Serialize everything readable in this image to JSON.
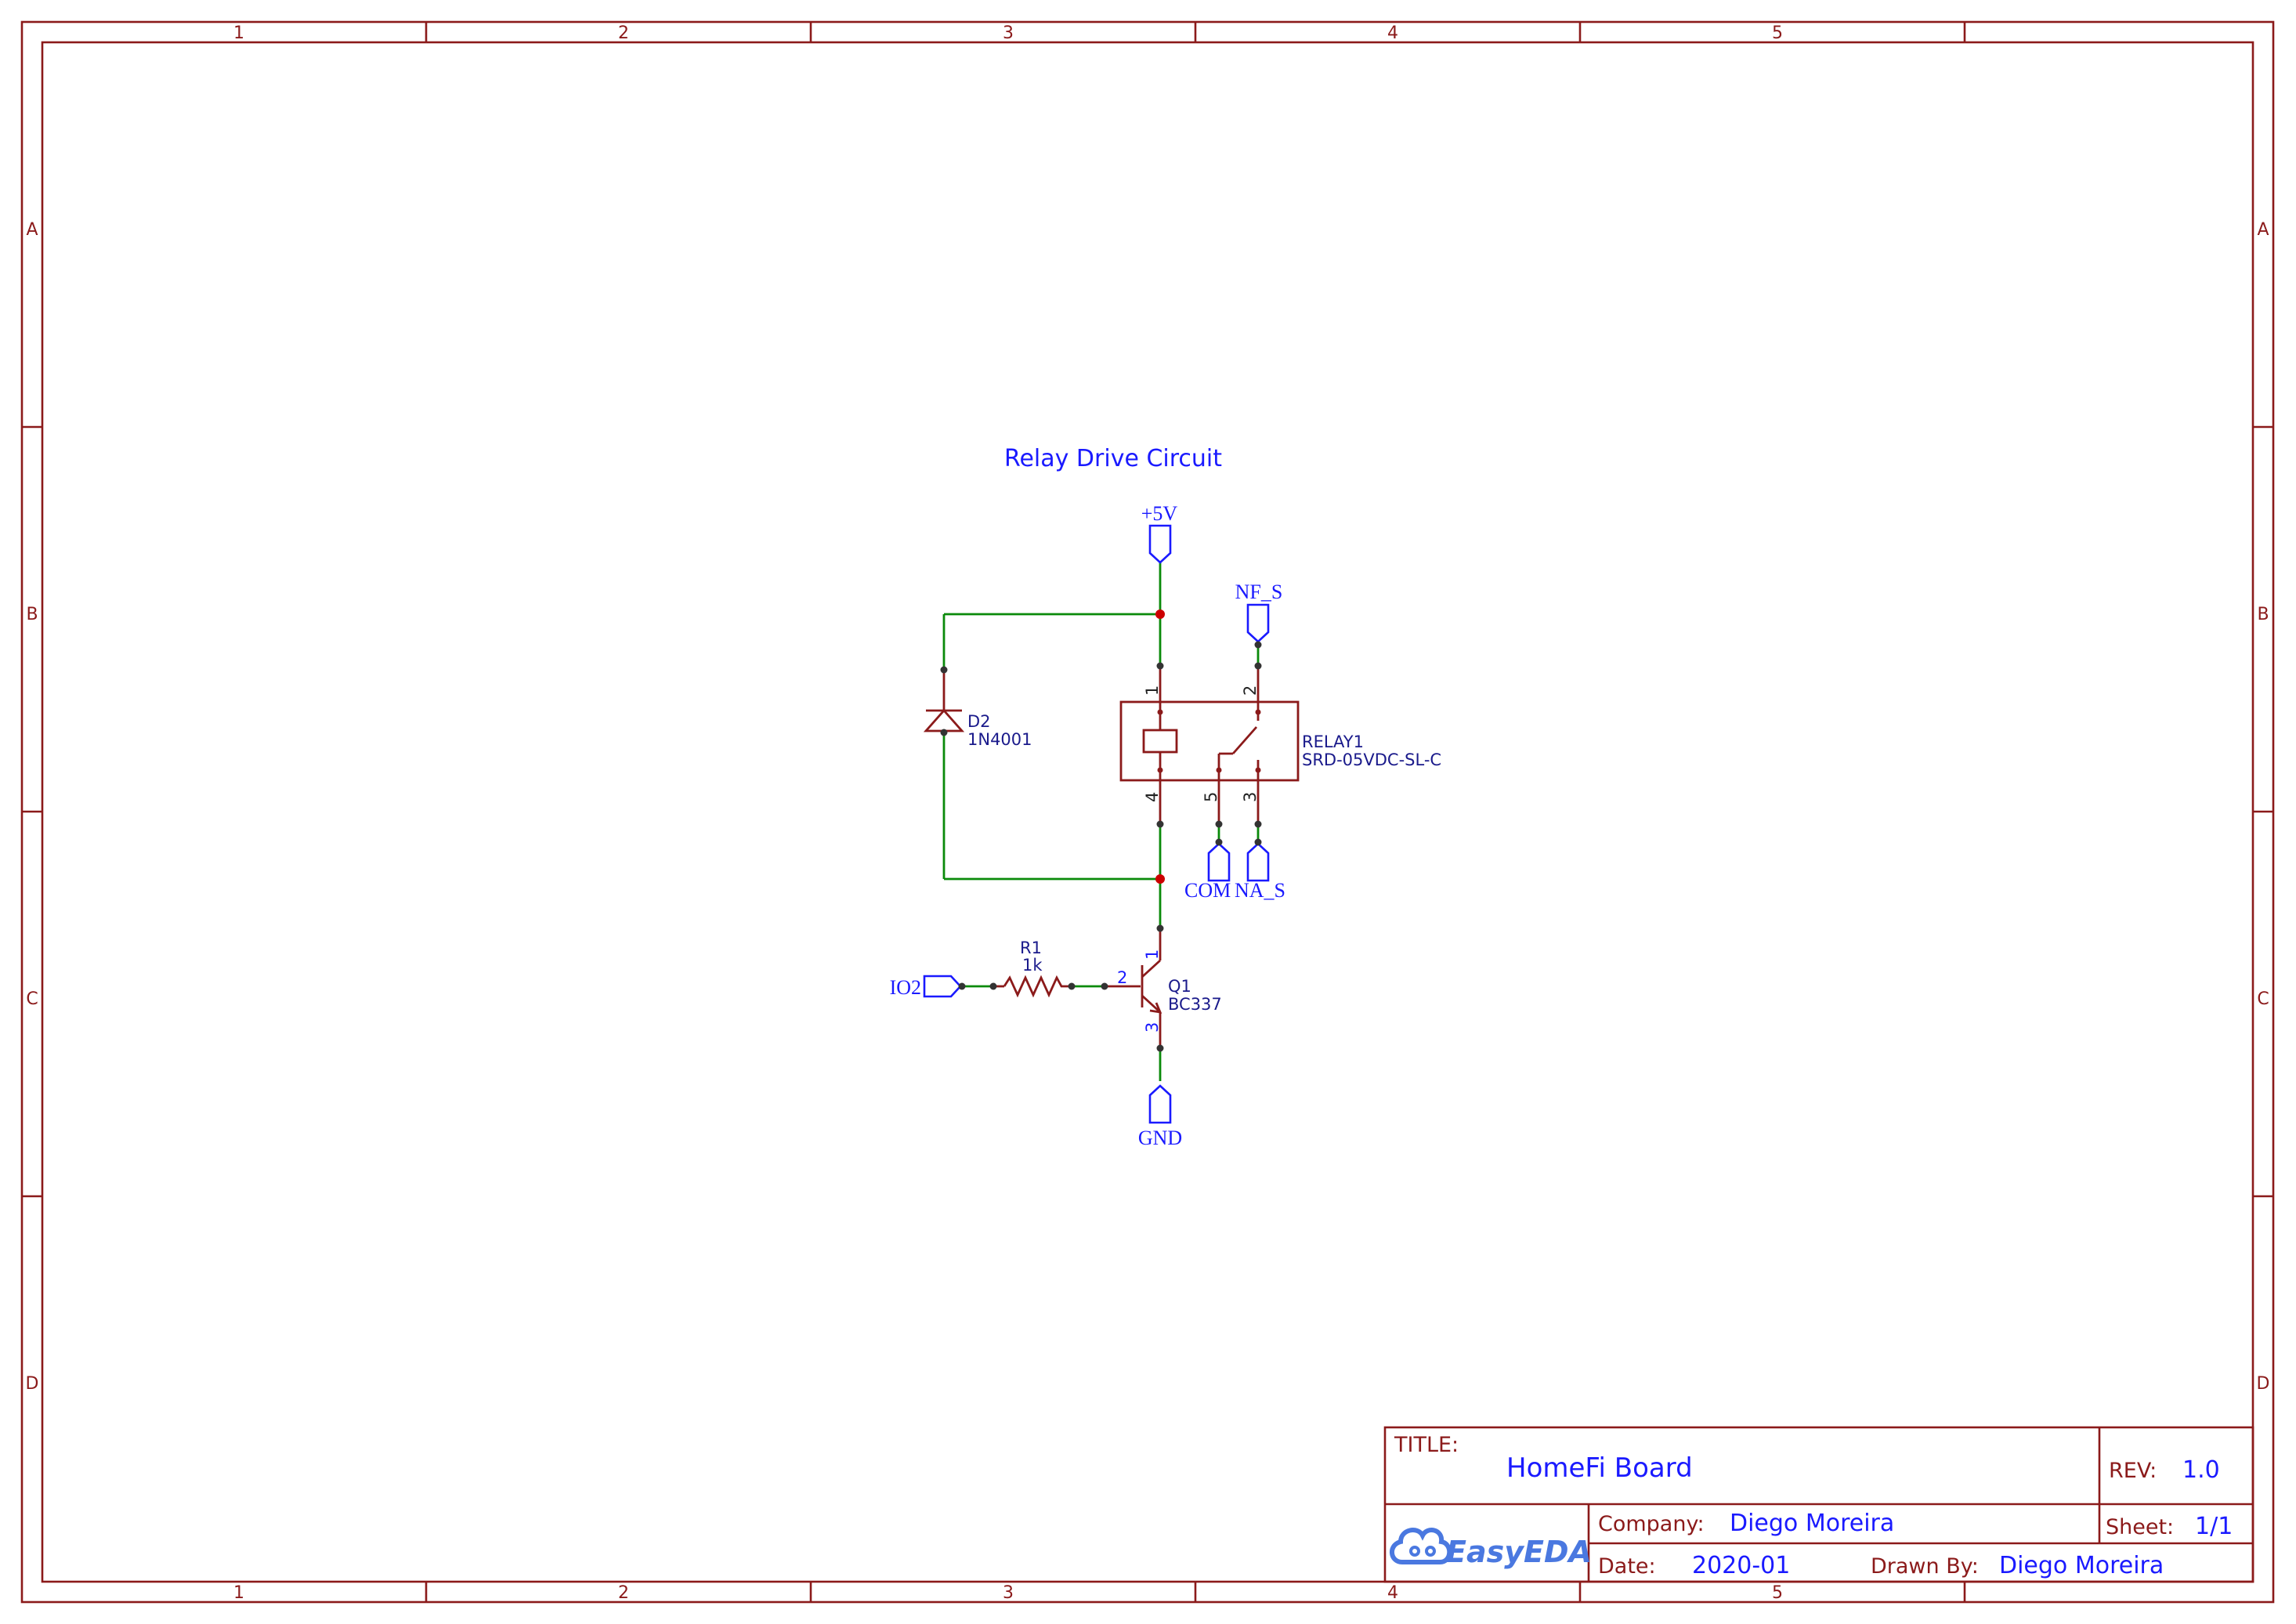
{
  "frame": {
    "columns": [
      "1",
      "2",
      "3",
      "4",
      "5"
    ],
    "rows": [
      "A",
      "B",
      "C",
      "D"
    ]
  },
  "diagram": {
    "section_title": "Relay Drive Circuit",
    "net_labels": {
      "vcc": "+5V",
      "nf": "NF_S",
      "com": "COM",
      "na": "NA_S",
      "gnd": "GND",
      "io": "IO2"
    },
    "components": {
      "diode": {
        "ref": "D2",
        "value": "1N4001"
      },
      "relay": {
        "ref": "RELAY1",
        "value": "SRD-05VDC-SL-C",
        "pins": [
          "1",
          "2",
          "4",
          "5",
          "3"
        ]
      },
      "resistor": {
        "ref": "R1",
        "value": "1k"
      },
      "transistor": {
        "ref": "Q1",
        "value": "BC337",
        "pins": [
          "1",
          "2",
          "3"
        ]
      }
    },
    "colors": {
      "frame": "#8b1a1a",
      "wire": "#0a8a0a",
      "net_label": "#1a1aff",
      "junction": "#cc0000"
    }
  },
  "title_block": {
    "title_label": "TITLE:",
    "title": "HomeFi Board",
    "rev_label": "REV:",
    "rev": "1.0",
    "company_label": "Company:",
    "company": "Diego Moreira",
    "sheet_label": "Sheet:",
    "sheet": "1/1",
    "date_label": "Date:",
    "date": "2020-01",
    "drawn_by_label": "Drawn By:",
    "drawn_by": "Diego Moreira",
    "logo_text": "EasyEDA"
  }
}
